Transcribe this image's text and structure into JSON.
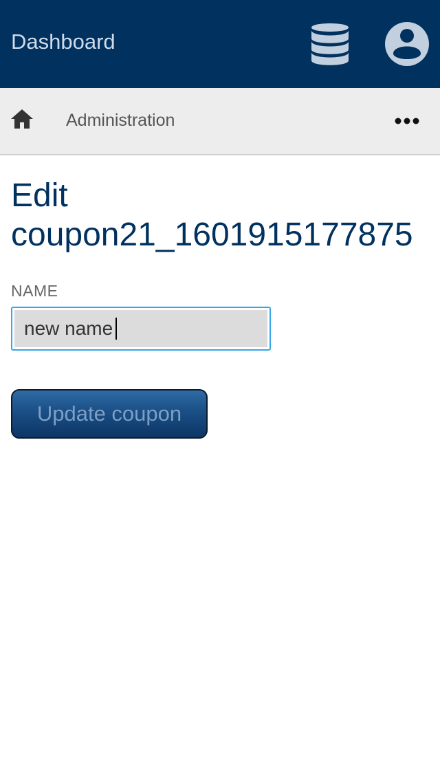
{
  "header": {
    "title": "Dashboard",
    "icons": [
      "database-icon",
      "user-account-icon"
    ],
    "background_color": "#00315f"
  },
  "breadcrumb": {
    "home_icon": "home-icon",
    "items": [
      "Administration"
    ],
    "more_icon": "more-horizontal-icon"
  },
  "page": {
    "title_line1": "Edit",
    "title_line2": "coupon21_1601915177875"
  },
  "form": {
    "name_label": "NAME",
    "name_value": "new name",
    "submit_label": "Update coupon"
  }
}
